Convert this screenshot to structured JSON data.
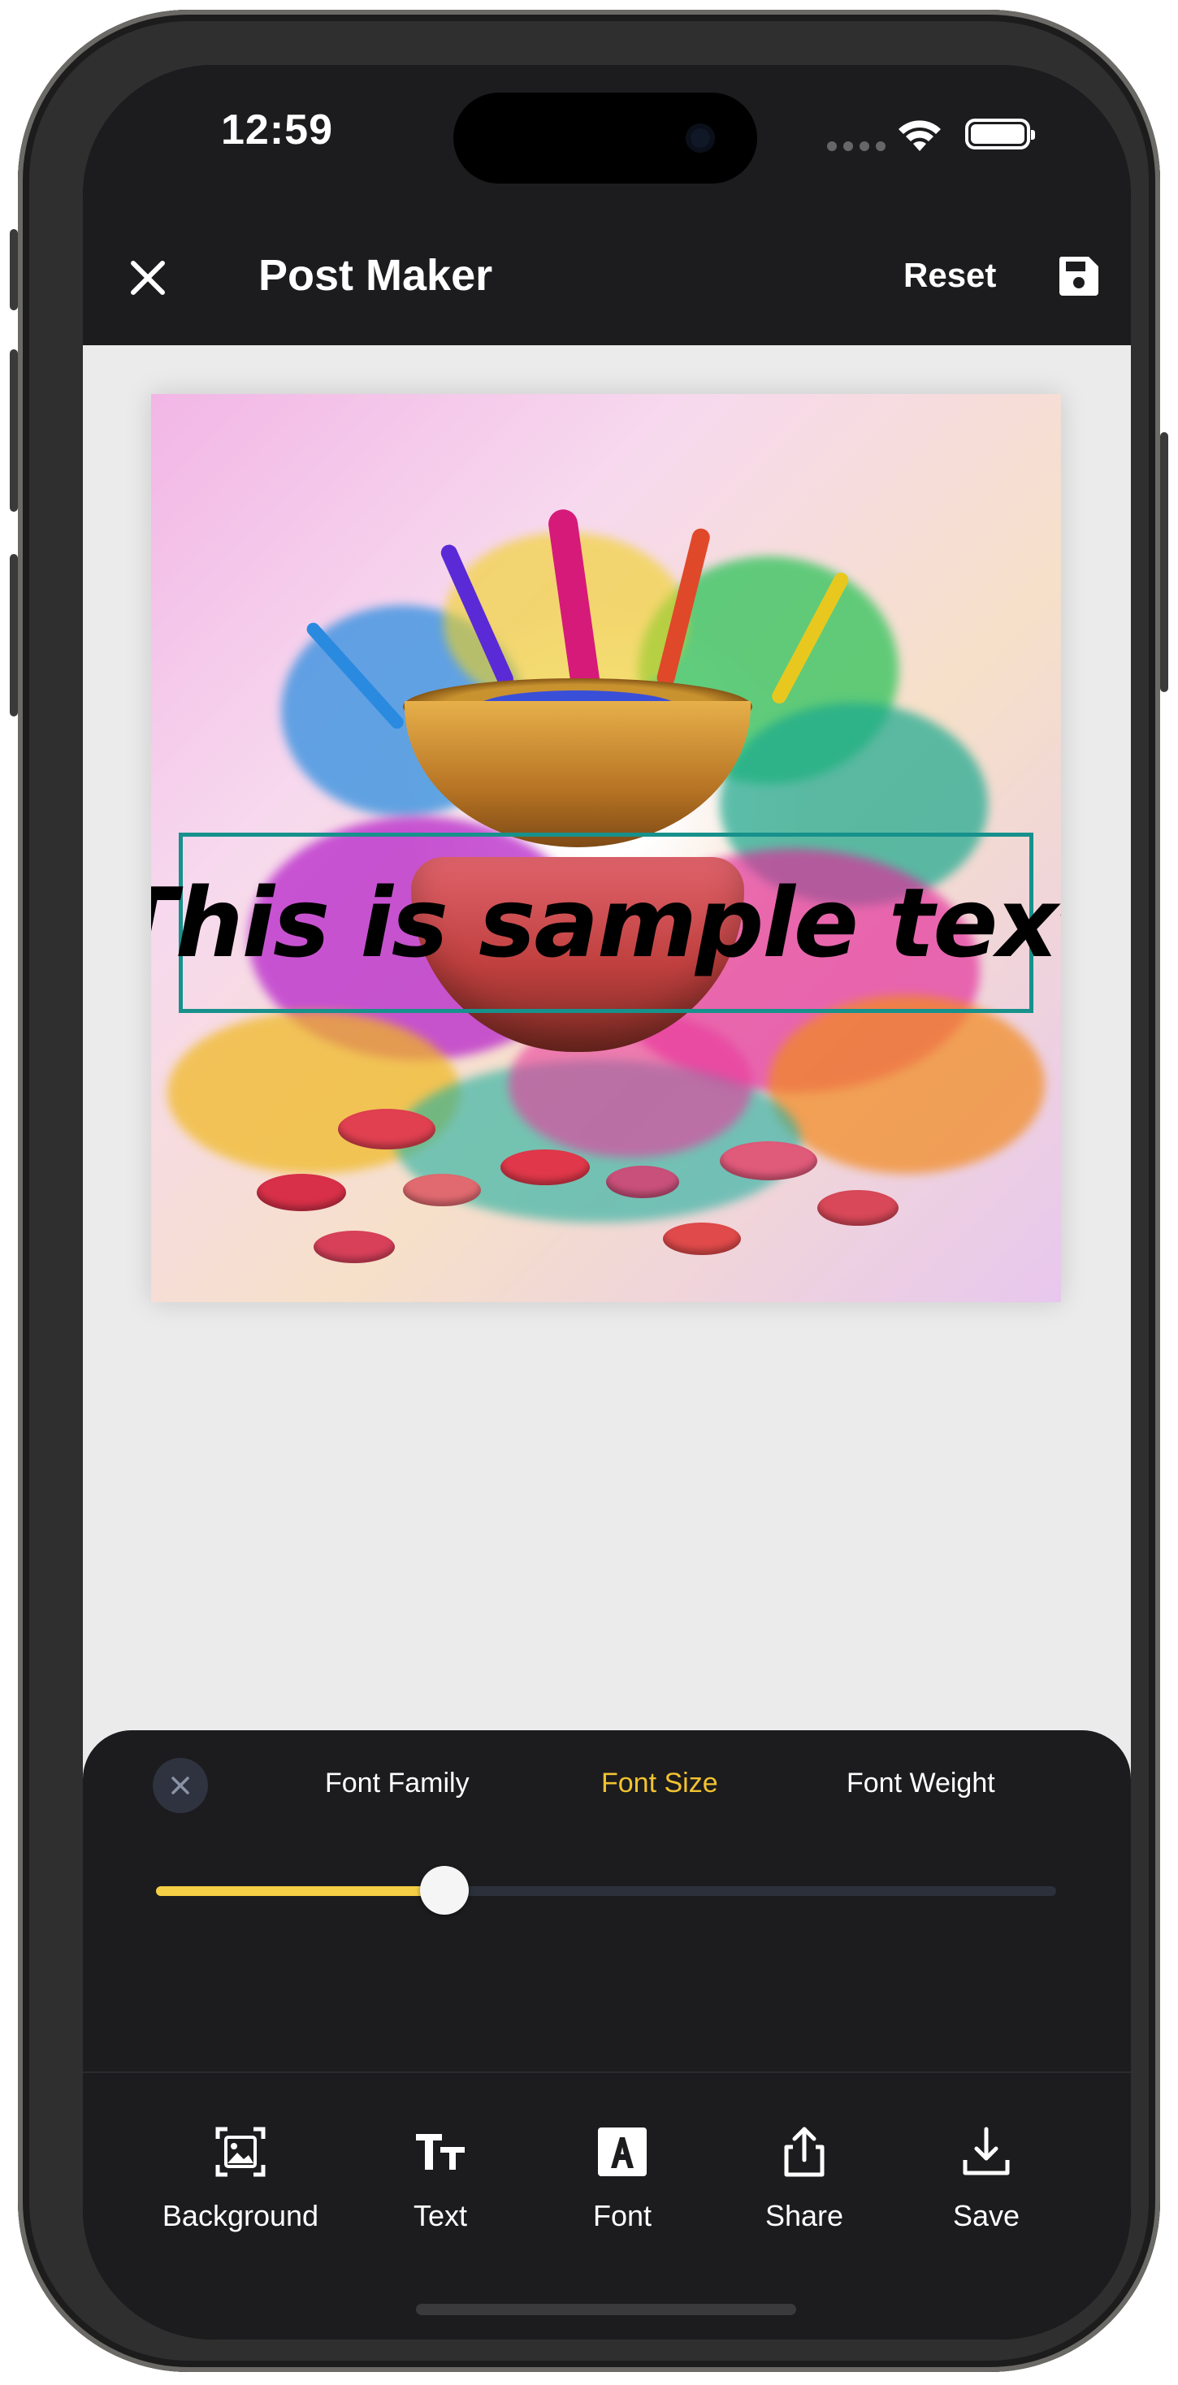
{
  "status_bar": {
    "time": "12:59"
  },
  "header": {
    "title": "Post Maker",
    "reset_label": "Reset",
    "close_icon": "close-icon",
    "save_icon": "floppy-disk-icon"
  },
  "poster": {
    "sample_text": "This is sample text"
  },
  "panel": {
    "tabs": [
      {
        "label": "Font Family",
        "active": false
      },
      {
        "label": "Font Size",
        "active": true
      },
      {
        "label": "Font Weight",
        "active": false
      }
    ],
    "font_size_fraction": 0.32
  },
  "toolbar": {
    "items": [
      {
        "label": "Background",
        "icon": "background-image-icon"
      },
      {
        "label": "Text",
        "icon": "text-size-icon"
      },
      {
        "label": "Font",
        "icon": "font-letter-icon"
      },
      {
        "label": "Share",
        "icon": "share-icon"
      },
      {
        "label": "Save",
        "icon": "download-icon"
      }
    ]
  },
  "colors": {
    "accent": "#f2c230",
    "selection_border": "#17918c",
    "panel_bg": "#1c1c1e",
    "canvas_bg": "#ebebeb"
  }
}
